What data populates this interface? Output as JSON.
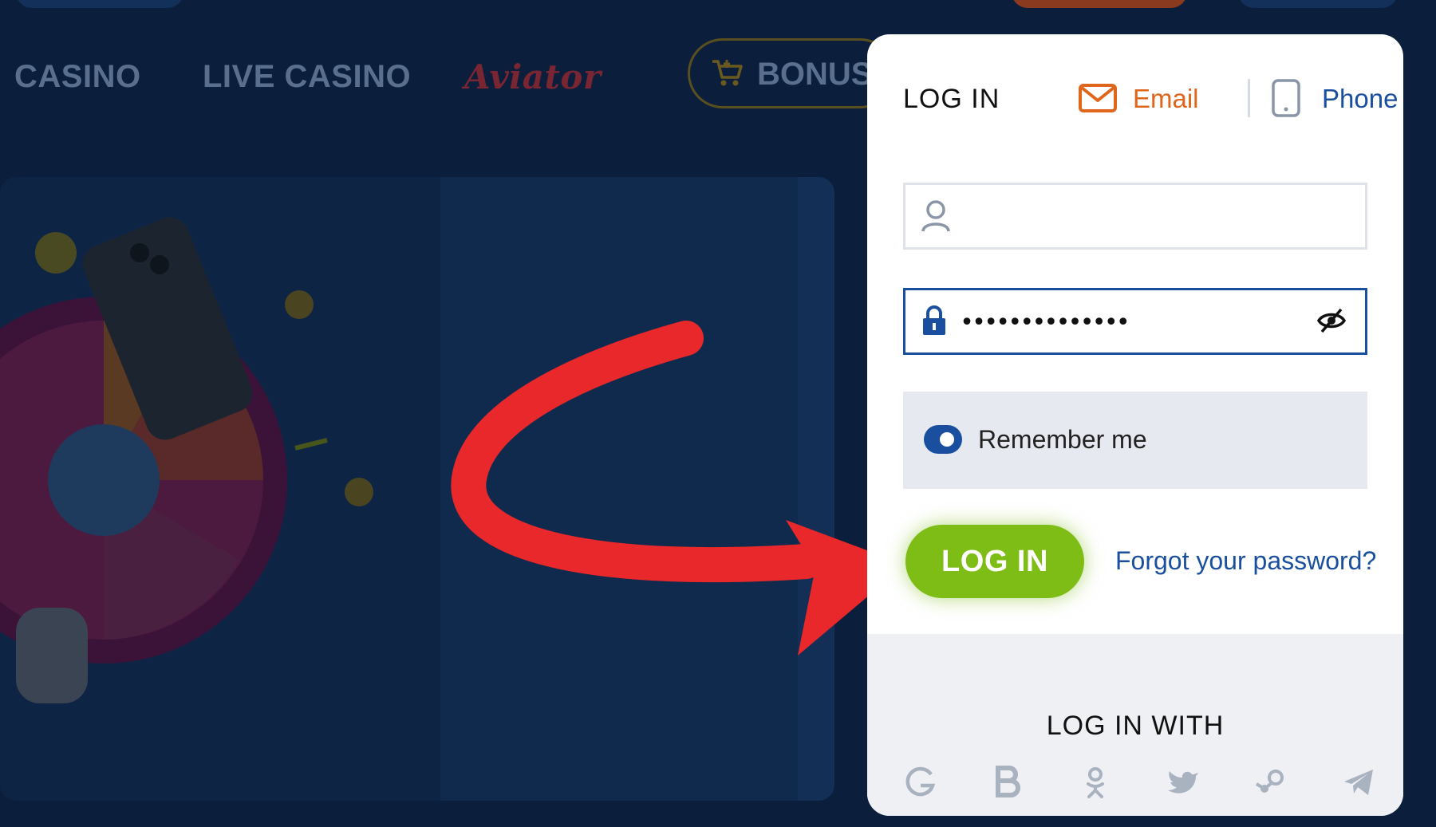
{
  "nav": {
    "items": [
      {
        "label": "CASINO"
      },
      {
        "label": "LIVE CASINO"
      },
      {
        "label": "Aviator"
      }
    ],
    "bonus_label": "BONUS"
  },
  "login": {
    "title": "LOG IN",
    "tabs": {
      "email": "Email",
      "phone": "Phone"
    },
    "username": {
      "value": "",
      "placeholder": ""
    },
    "password": {
      "value": "••••••••••••••"
    },
    "remember_label": "Remember me",
    "remember_checked": true,
    "submit_label": "LOG IN",
    "forgot_label": "Forgot your password?",
    "social_title": "LOG IN WITH",
    "social_icons": [
      "google-icon",
      "vk-b-icon",
      "odnoklassniki-icon",
      "twitter-icon",
      "steam-icon",
      "telegram-icon"
    ]
  },
  "colors": {
    "background": "#0b1f3d",
    "accent_orange": "#e0661b",
    "accent_blue": "#1a4e9e",
    "button_green": "#7ebc16",
    "arrow_red": "#e8282a"
  }
}
